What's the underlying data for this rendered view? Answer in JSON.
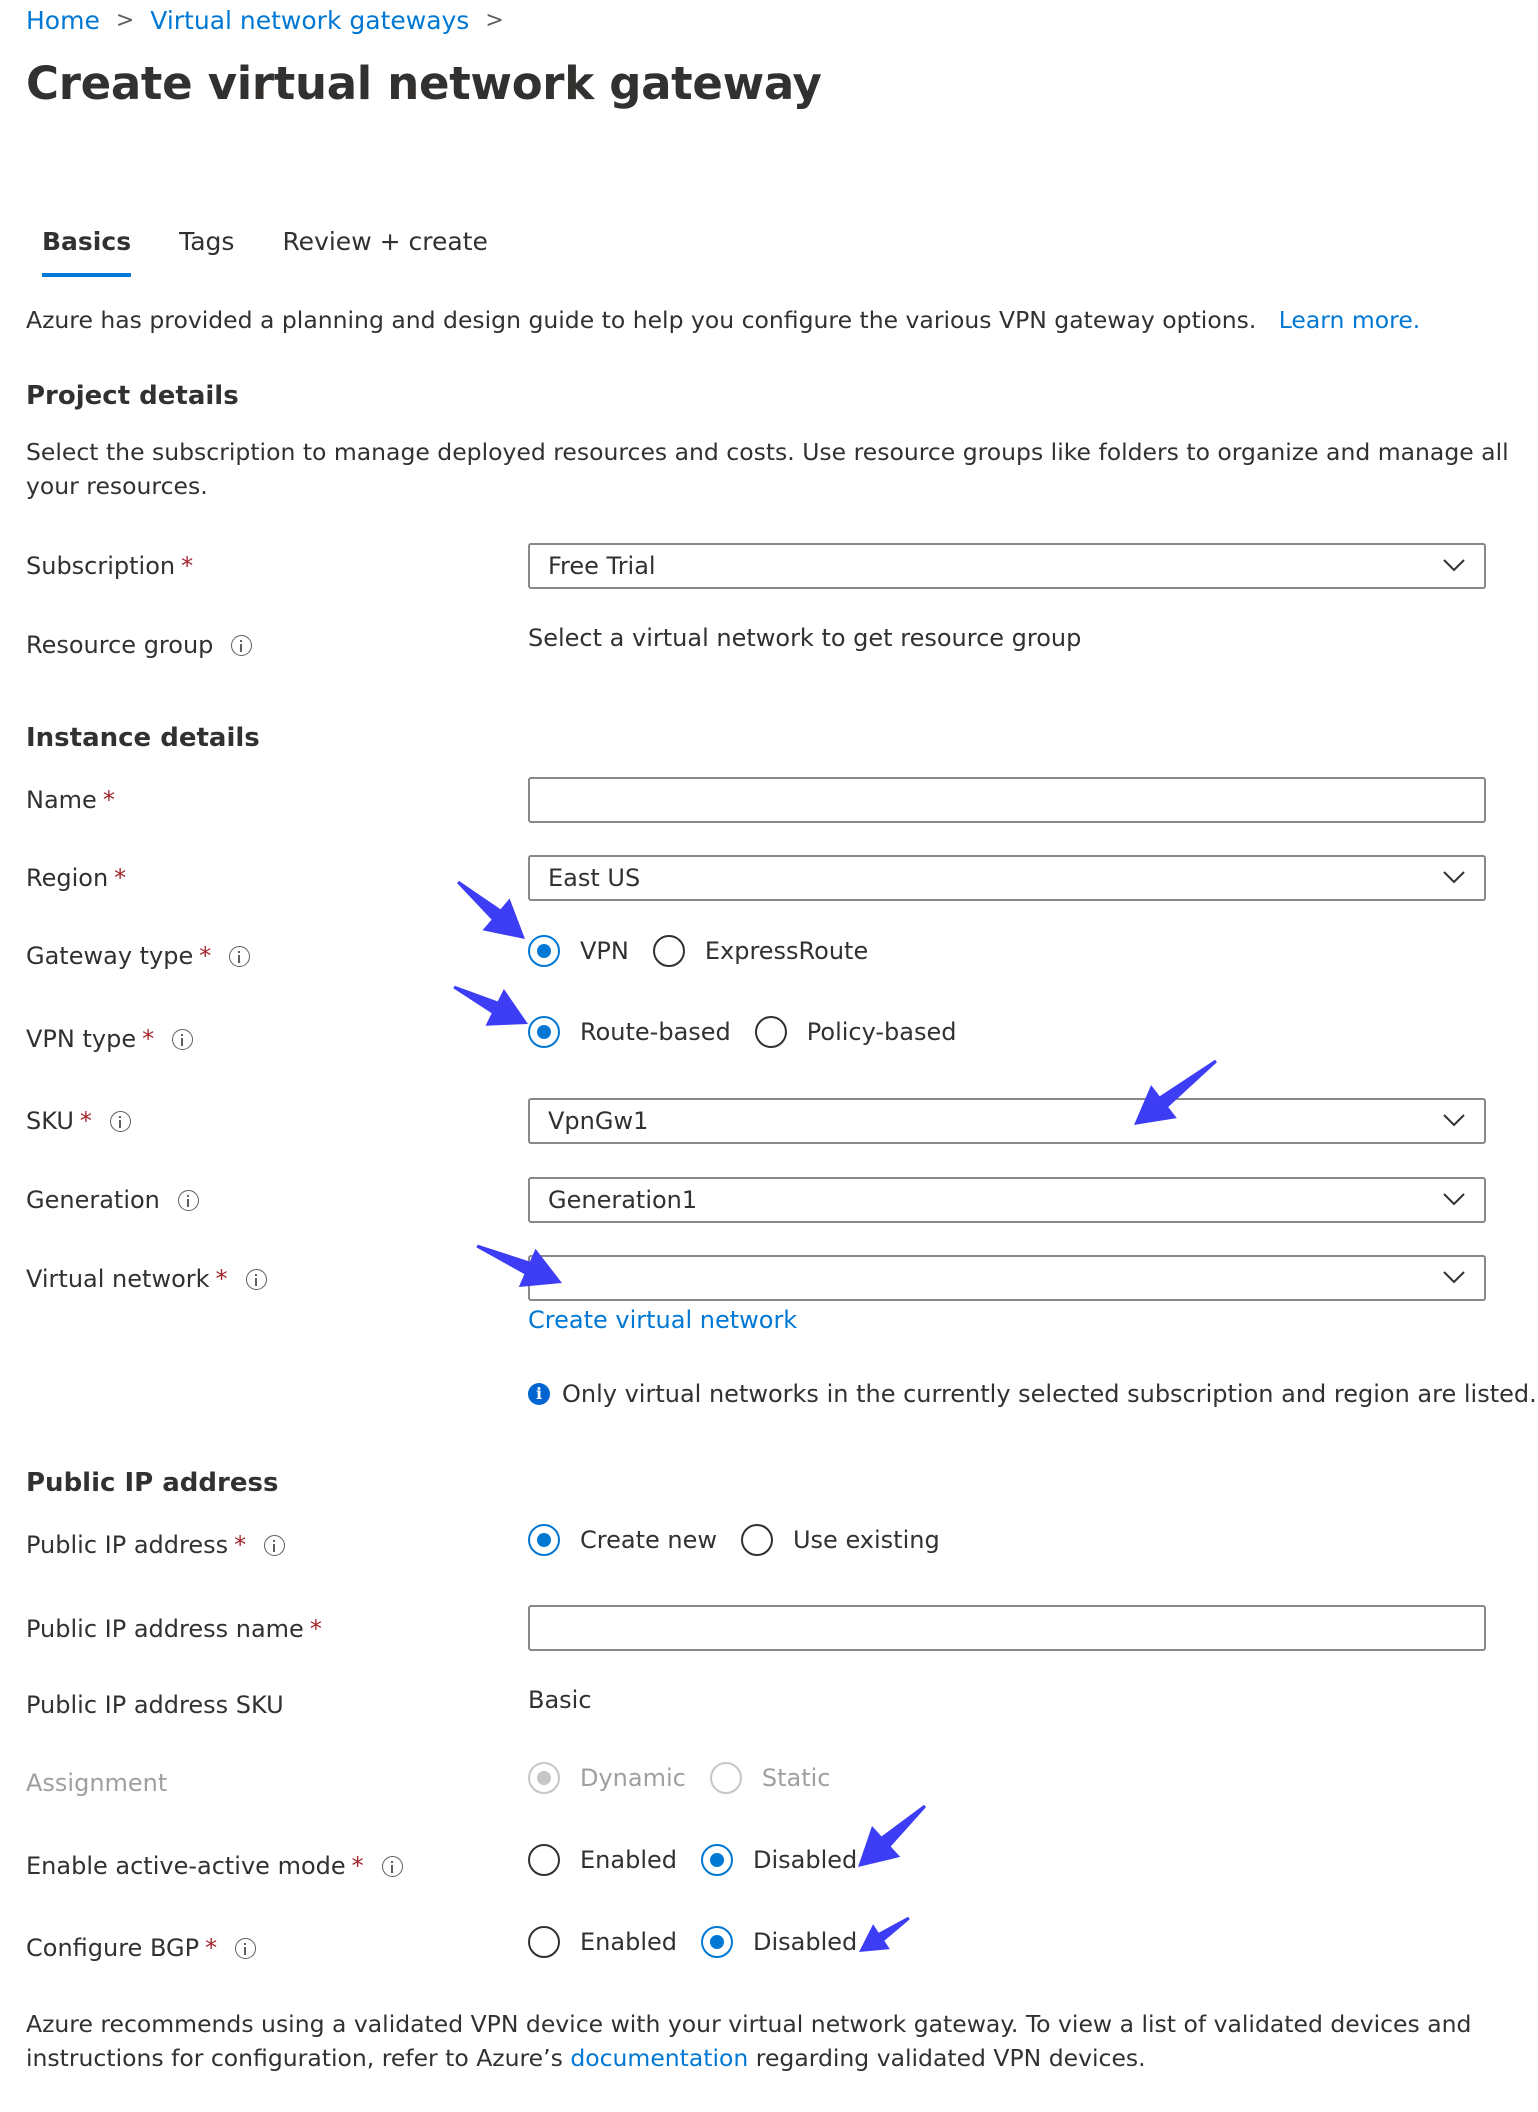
{
  "breadcrumb": {
    "items": [
      "Home",
      "Virtual network gateways"
    ],
    "separator": ">"
  },
  "page_title": "Create virtual network gateway",
  "tabs": [
    {
      "label": "Basics",
      "active": true
    },
    {
      "label": "Tags",
      "active": false
    },
    {
      "label": "Review + create",
      "active": false
    }
  ],
  "intro": {
    "text": "Azure has provided a planning and design guide to help you configure the various VPN gateway options.",
    "link": "Learn more."
  },
  "project_details": {
    "heading": "Project details",
    "description_line1": "Select the subscription to manage deployed resources and costs. Use resource groups like folders to organize and manage all",
    "description_line2": "your resources.",
    "subscription": {
      "label": "Subscription",
      "value": "Free Trial"
    },
    "resource_group": {
      "label": "Resource group",
      "value": "Select a virtual network to get resource group"
    }
  },
  "instance_details": {
    "heading": "Instance details",
    "name": {
      "label": "Name",
      "value": ""
    },
    "region": {
      "label": "Region",
      "value": "East US"
    },
    "gateway_type": {
      "label": "Gateway type",
      "options": [
        "VPN",
        "ExpressRoute"
      ],
      "selected": "VPN"
    },
    "vpn_type": {
      "label": "VPN type",
      "options": [
        "Route-based",
        "Policy-based"
      ],
      "selected": "Route-based"
    },
    "sku": {
      "label": "SKU",
      "value": "VpnGw1"
    },
    "generation": {
      "label": "Generation",
      "value": "Generation1"
    },
    "virtual_network": {
      "label": "Virtual network",
      "value": "",
      "create_link": "Create virtual network",
      "note": "Only virtual networks in the currently selected subscription and region are listed."
    }
  },
  "public_ip": {
    "heading": "Public IP address",
    "address": {
      "label": "Public IP address",
      "options": [
        "Create new",
        "Use existing"
      ],
      "selected": "Create new"
    },
    "name": {
      "label": "Public IP address name",
      "value": ""
    },
    "sku": {
      "label": "Public IP address SKU",
      "value": "Basic"
    },
    "assignment": {
      "label": "Assignment",
      "options": [
        "Dynamic",
        "Static"
      ],
      "selected": "Dynamic",
      "disabled": true
    },
    "active_active": {
      "label": "Enable active-active mode",
      "options": [
        "Enabled",
        "Disabled"
      ],
      "selected": "Disabled"
    },
    "bgp": {
      "label": "Configure BGP",
      "options": [
        "Enabled",
        "Disabled"
      ],
      "selected": "Disabled"
    }
  },
  "footer": {
    "line1": "Azure recommends using a validated VPN device with your virtual network gateway. To view a list of validated devices and",
    "line2_prefix": "instructions for configuration, refer to Azure’s",
    "line2_link": "documentation",
    "line2_suffix": "regarding validated VPN devices."
  },
  "colors": {
    "accent": "#0078d4",
    "required": "#a4262c",
    "annotation_arrow": "#3d3df5"
  },
  "required_marker": "*"
}
